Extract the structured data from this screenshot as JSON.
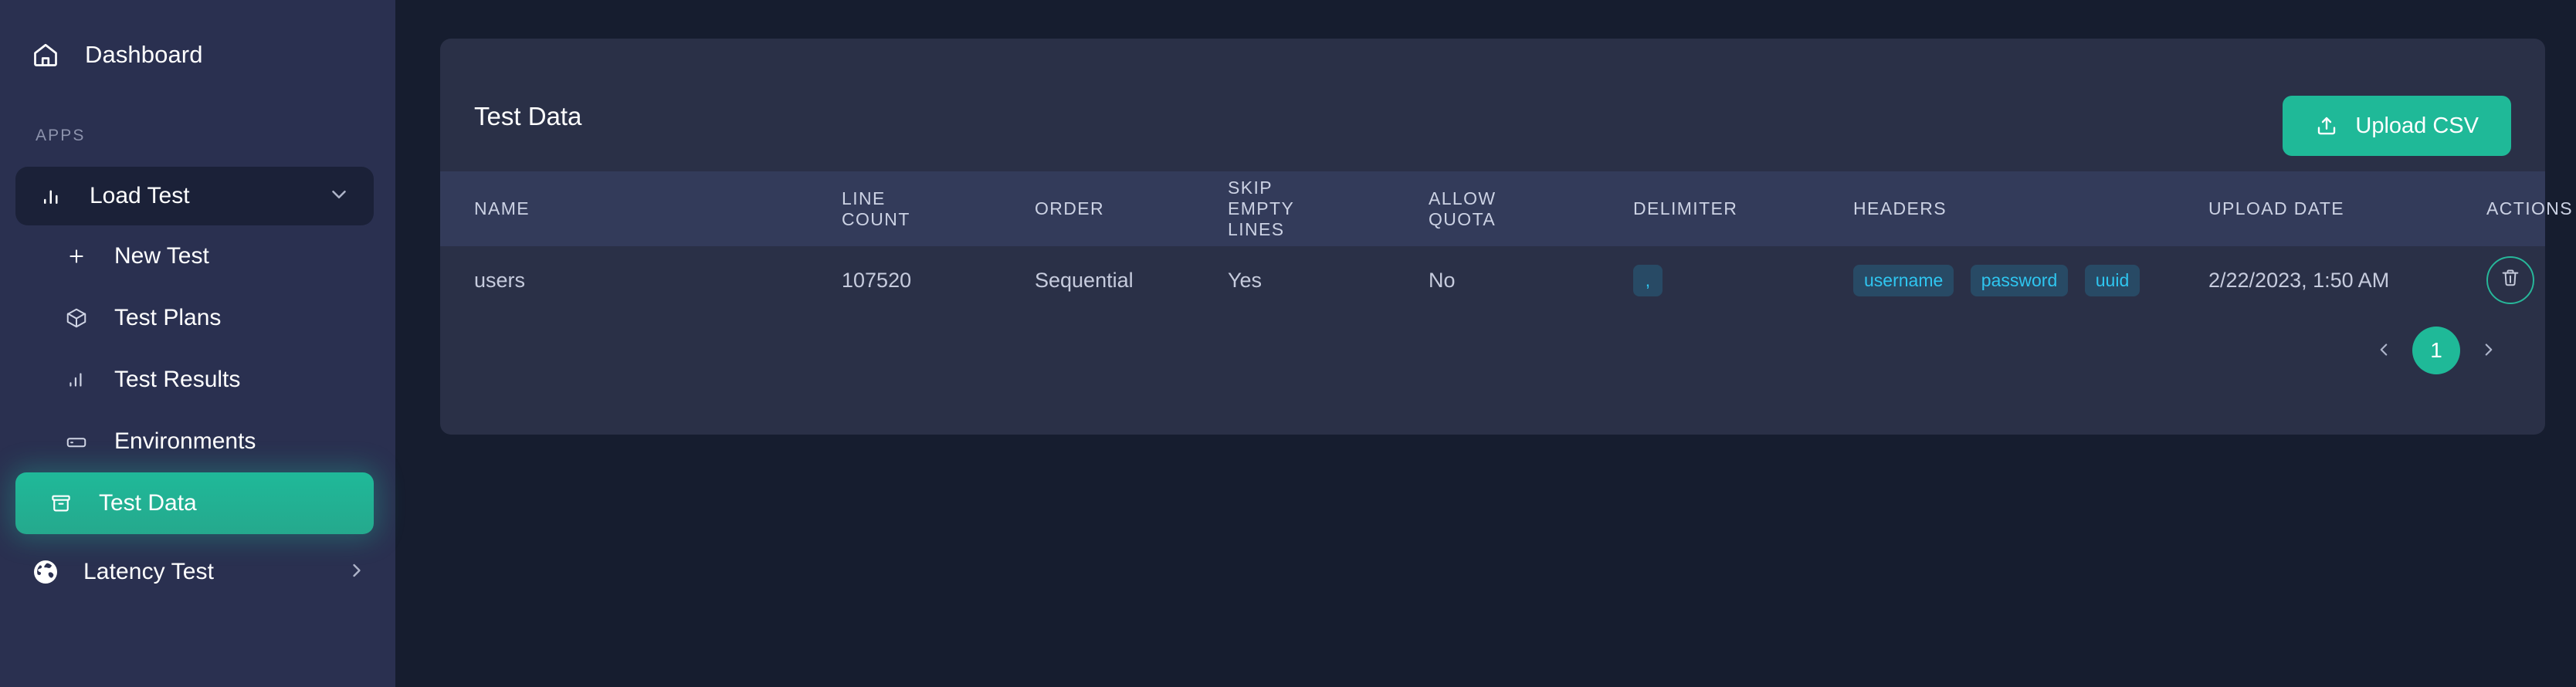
{
  "sidebar": {
    "dashboard": {
      "label": "Dashboard",
      "icon": "home-icon"
    },
    "section_label": "APPS",
    "group": {
      "label": "Load Test",
      "icon": "bar-chart-icon",
      "chevron": "chevron-down-icon"
    },
    "items": [
      {
        "label": "New Test",
        "icon": "plus-icon"
      },
      {
        "label": "Test Plans",
        "icon": "package-icon"
      },
      {
        "label": "Test Results",
        "icon": "bar-chart-icon"
      },
      {
        "label": "Environments",
        "icon": "server-icon"
      },
      {
        "label": "Test Data",
        "icon": "archive-icon",
        "active": true
      }
    ],
    "latency": {
      "label": "Latency Test",
      "icon": "globe-icon",
      "chevron": "chevron-right-icon"
    }
  },
  "card": {
    "title": "Test Data",
    "upload_button": {
      "label": "Upload CSV",
      "icon": "upload-icon"
    }
  },
  "table": {
    "columns": [
      "NAME",
      "LINE COUNT",
      "ORDER",
      "SKIP EMPTY LINES",
      "ALLOW QUOTA",
      "DELIMITER",
      "HEADERS",
      "UPLOAD DATE",
      "ACTIONS"
    ],
    "rows": [
      {
        "name": "users",
        "line_count": "107520",
        "order": "Sequential",
        "skip_empty_lines": "Yes",
        "allow_quota": "No",
        "delimiter": ",",
        "headers": [
          "username",
          "password",
          "uuid"
        ],
        "upload_date": "2/22/2023, 1:50 AM",
        "action_icon": "trash-icon"
      }
    ]
  },
  "pagination": {
    "prev_icon": "chevron-left-icon",
    "next_icon": "chevron-right-icon",
    "current_page": "1"
  },
  "colors": {
    "accent": "#1fb998",
    "chip_text": "#2fc6f0",
    "sidebar_bg": "#2a3050",
    "page_bg": "#161d2f",
    "card_bg": "#2a3047",
    "table_head_bg": "#333b5a"
  }
}
